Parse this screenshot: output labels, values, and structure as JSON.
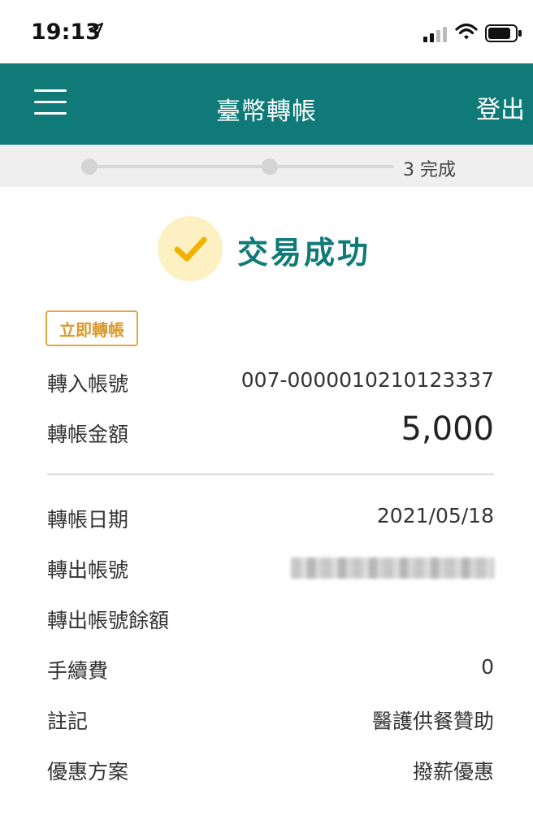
{
  "status_bar": {
    "time": "19:13",
    "icons": [
      "location-arrow-icon",
      "signal-icon",
      "wifi-icon",
      "battery-icon"
    ]
  },
  "header": {
    "title": "臺幣轉帳",
    "logout_label": "登出",
    "menu_icon": "hamburger-menu-icon",
    "color": "#0f7a78"
  },
  "progress": {
    "step_label": "3 完成"
  },
  "result": {
    "message": "交易成功",
    "icon": "check-icon",
    "accent": "#f0b400"
  },
  "tag": "立即轉帳",
  "summary": [
    {
      "label": "轉入帳號",
      "value": "007-0000010210123337"
    },
    {
      "label": "轉帳金額",
      "value": "5,000"
    }
  ],
  "details": [
    {
      "label": "轉帳日期",
      "value": "2021/05/18"
    },
    {
      "label": "轉出帳號",
      "value": ""
    },
    {
      "label": "轉出帳號餘額",
      "value": ""
    },
    {
      "label": "手續費",
      "value": "0"
    },
    {
      "label": "註記",
      "value": "醫護供餐贊助"
    },
    {
      "label": "優惠方案",
      "value": "撥薪優惠"
    }
  ]
}
